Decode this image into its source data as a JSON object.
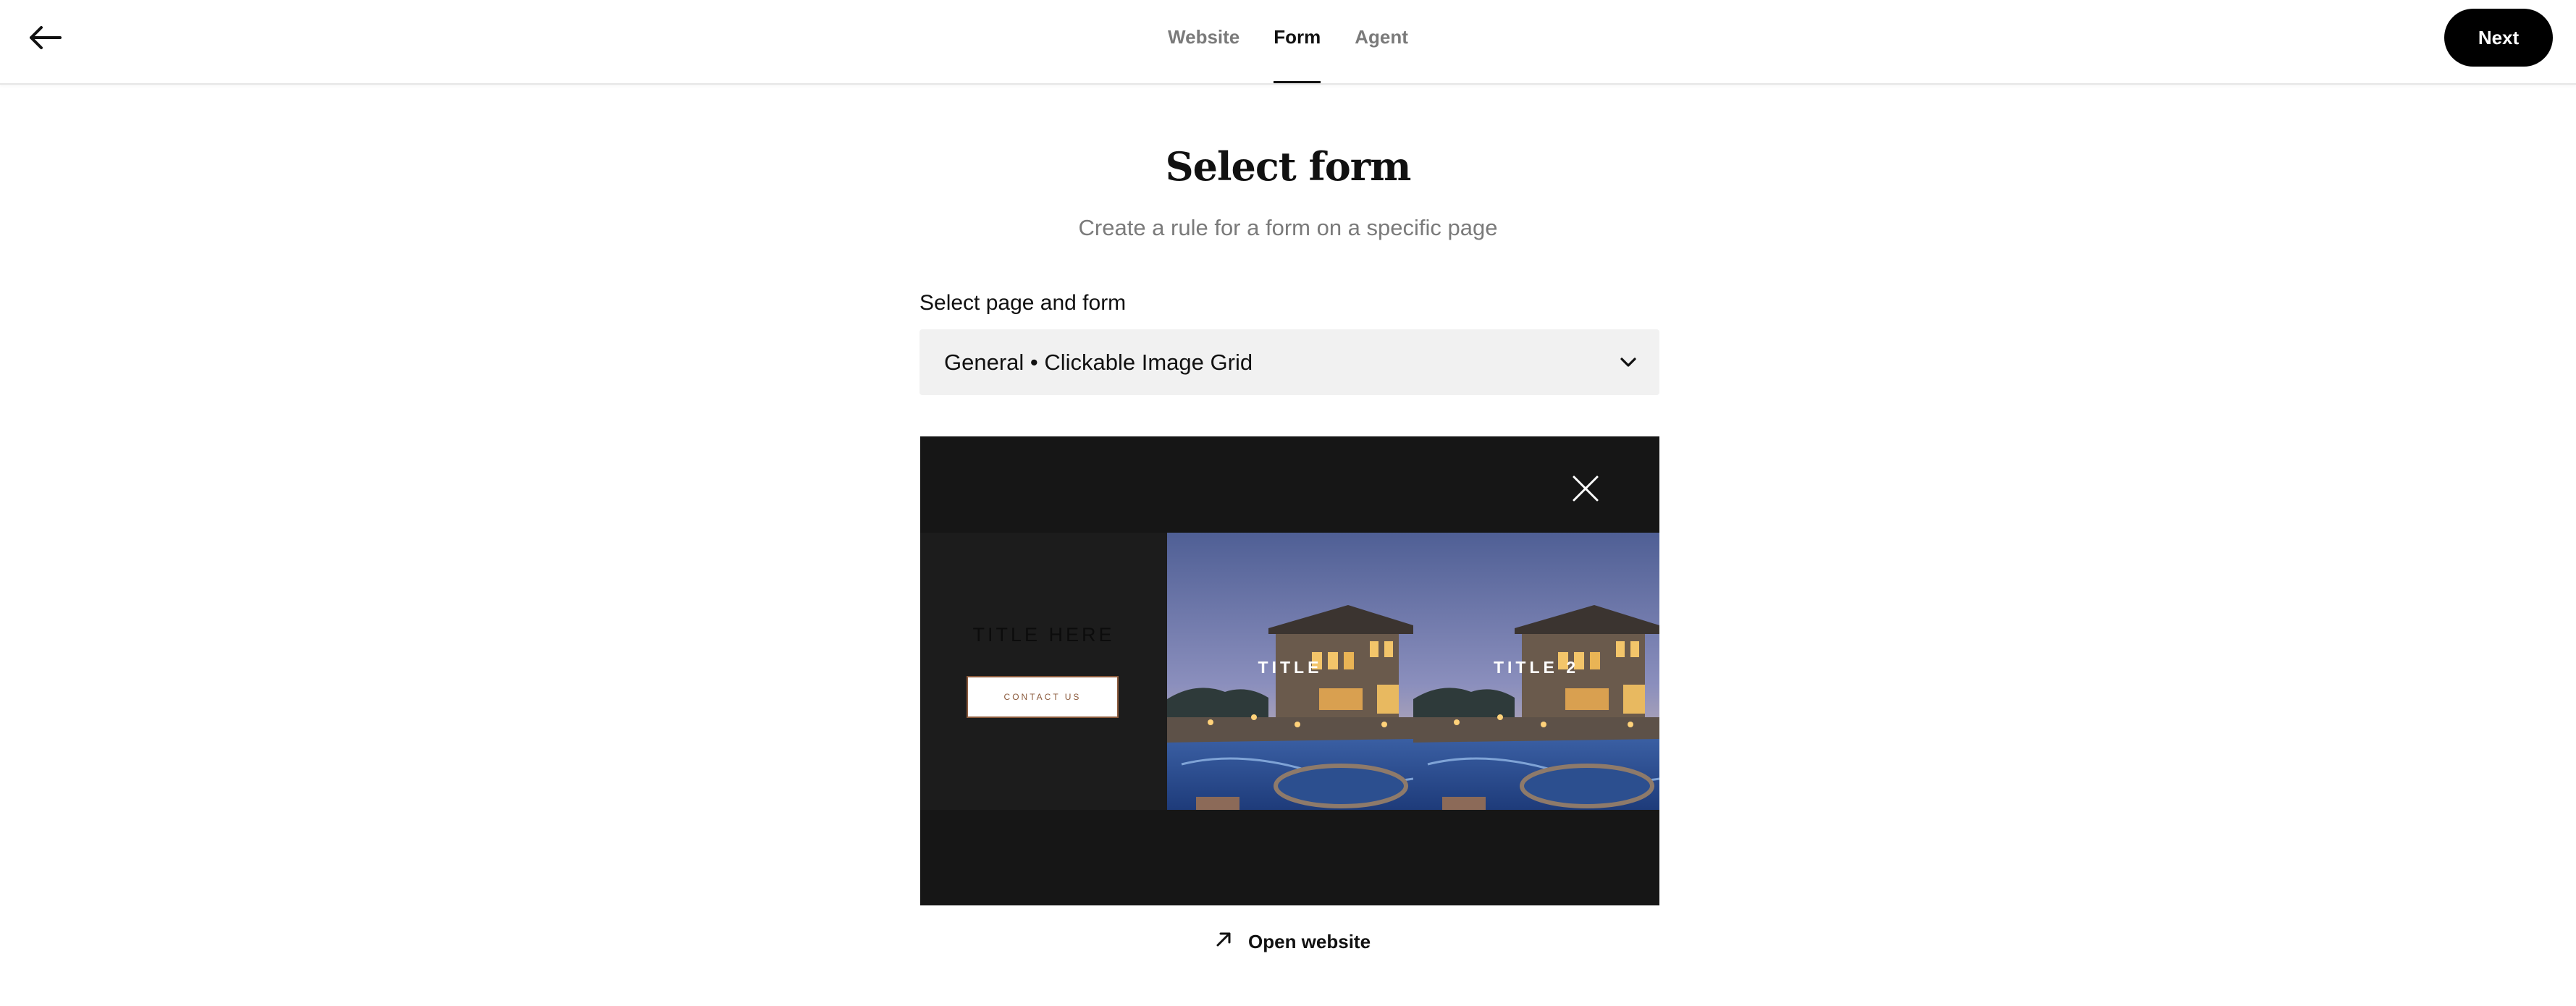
{
  "header": {
    "back_icon": "arrow-left-icon",
    "tabs": [
      {
        "label": "Website",
        "active": false
      },
      {
        "label": "Form",
        "active": true
      },
      {
        "label": "Agent",
        "active": false
      }
    ],
    "next_label": "Next"
  },
  "main": {
    "title": "Select form",
    "subtitle": "Create a rule for a form on a specific page",
    "select_label": "Select page and form",
    "select_value": "General • Clickable Image Grid",
    "select_icon": "chevron-down-icon"
  },
  "preview": {
    "close_icon": "close-icon",
    "text_cell_title": "TITLE HERE",
    "contact_label": "CONTACT US",
    "images": [
      {
        "label": "TITLE"
      },
      {
        "label": "TITLE 2"
      }
    ]
  },
  "footer": {
    "open_website_icon": "arrow-up-right-icon",
    "open_website_label": "Open website"
  },
  "colors": {
    "primary": "#000000",
    "muted_text": "#7a7a7a",
    "select_bg": "#f1f1f1",
    "preview_bg": "#161616",
    "contact_accent": "#8b5a3c"
  }
}
